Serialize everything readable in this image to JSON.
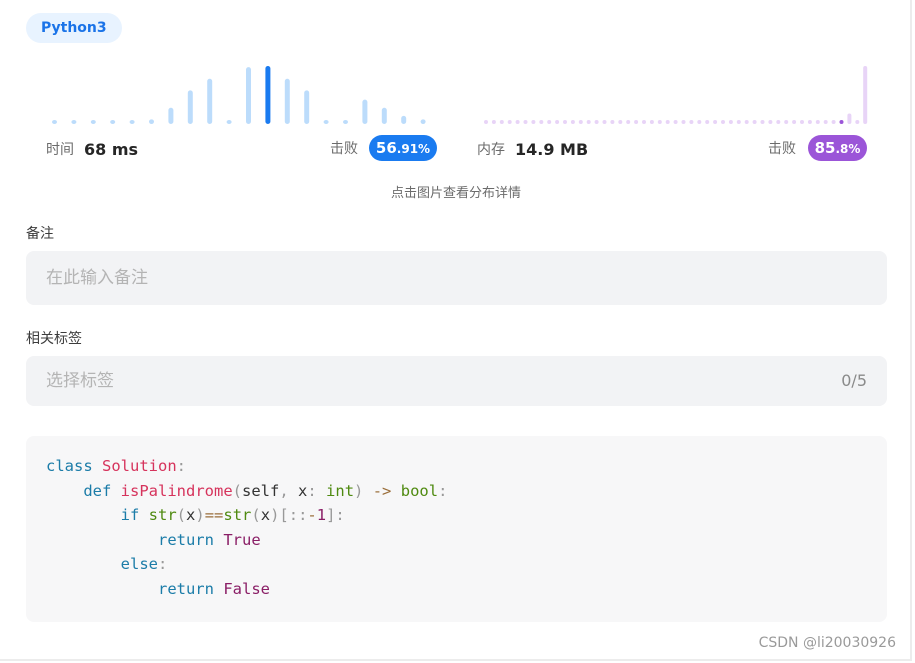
{
  "language_badge": "Python3",
  "runtime": {
    "label": "时间",
    "value": "68 ms",
    "beat_label": "击败",
    "beat_main": "56",
    "beat_small": ".91%",
    "accent": "#1a7bf0",
    "bar_color": "#bcdcfb",
    "bar_levels": [
      0.04,
      0.04,
      0.04,
      0.04,
      0.04,
      0.08,
      0.28,
      0.58,
      0.78,
      0.04,
      0.98,
      1.0,
      0.78,
      0.58,
      0.04,
      0.04,
      0.42,
      0.28,
      0.14,
      0.08
    ],
    "highlight_index": 11
  },
  "memory": {
    "label": "内存",
    "value": "14.9 MB",
    "beat_label": "击败",
    "beat_main": "85",
    "beat_small": ".8%",
    "accent": "#9b55d8",
    "bar_color": "#e8d4f7",
    "bar_levels": [
      0.04,
      0.04,
      0.04,
      0.04,
      0.04,
      0.04,
      0.04,
      0.04,
      0.04,
      0.04,
      0.04,
      0.04,
      0.04,
      0.04,
      0.04,
      0.04,
      0.04,
      0.04,
      0.04,
      0.04,
      0.04,
      0.04,
      0.04,
      0.04,
      0.04,
      0.04,
      0.04,
      0.04,
      0.04,
      0.04,
      0.04,
      0.04,
      0.04,
      0.04,
      0.04,
      0.04,
      0.04,
      0.04,
      0.04,
      0.04,
      0.04,
      0.04,
      0.04,
      0.04,
      0.04,
      0.06,
      0.18,
      0.06,
      1.0
    ],
    "highlight_index": 45
  },
  "hint": "点击图片查看分布详情",
  "notes": {
    "label": "备注",
    "placeholder": "在此输入备注"
  },
  "tags": {
    "label": "相关标签",
    "placeholder": "选择标签",
    "count": "0/5"
  },
  "code_lines": [
    [
      [
        "kw",
        "class"
      ],
      [
        "tx",
        " "
      ],
      [
        "fn",
        "Solution"
      ],
      [
        "pu",
        ":"
      ]
    ],
    [
      [
        "tx",
        "    "
      ],
      [
        "kw",
        "def"
      ],
      [
        "tx",
        " "
      ],
      [
        "fn",
        "isPalindrome"
      ],
      [
        "pu",
        "("
      ],
      [
        "tx",
        "self"
      ],
      [
        "pu",
        ","
      ],
      [
        "tx",
        " x"
      ],
      [
        "pu",
        ":"
      ],
      [
        "tx",
        " "
      ],
      [
        "bi",
        "int"
      ],
      [
        "pu",
        ")"
      ],
      [
        "tx",
        " "
      ],
      [
        "op",
        "->"
      ],
      [
        "tx",
        " "
      ],
      [
        "bi",
        "bool"
      ],
      [
        "pu",
        ":"
      ]
    ],
    [
      [
        "tx",
        "        "
      ],
      [
        "kw",
        "if"
      ],
      [
        "tx",
        " "
      ],
      [
        "bi",
        "str"
      ],
      [
        "pu",
        "("
      ],
      [
        "tx",
        "x"
      ],
      [
        "pu",
        ")"
      ],
      [
        "op",
        "=="
      ],
      [
        "bi",
        "str"
      ],
      [
        "pu",
        "("
      ],
      [
        "tx",
        "x"
      ],
      [
        "pu",
        ")"
      ],
      [
        "pu",
        "[::"
      ],
      [
        "op",
        "-"
      ],
      [
        "lit",
        "1"
      ],
      [
        "pu",
        "]:"
      ]
    ],
    [
      [
        "tx",
        "            "
      ],
      [
        "kw",
        "return"
      ],
      [
        "tx",
        " "
      ],
      [
        "lit",
        "True"
      ]
    ],
    [
      [
        "tx",
        "        "
      ],
      [
        "kw",
        "else"
      ],
      [
        "pu",
        ":"
      ]
    ],
    [
      [
        "tx",
        "            "
      ],
      [
        "kw",
        "return"
      ],
      [
        "tx",
        " "
      ],
      [
        "lit",
        "False"
      ]
    ]
  ],
  "watermark": "CSDN @li20030926"
}
